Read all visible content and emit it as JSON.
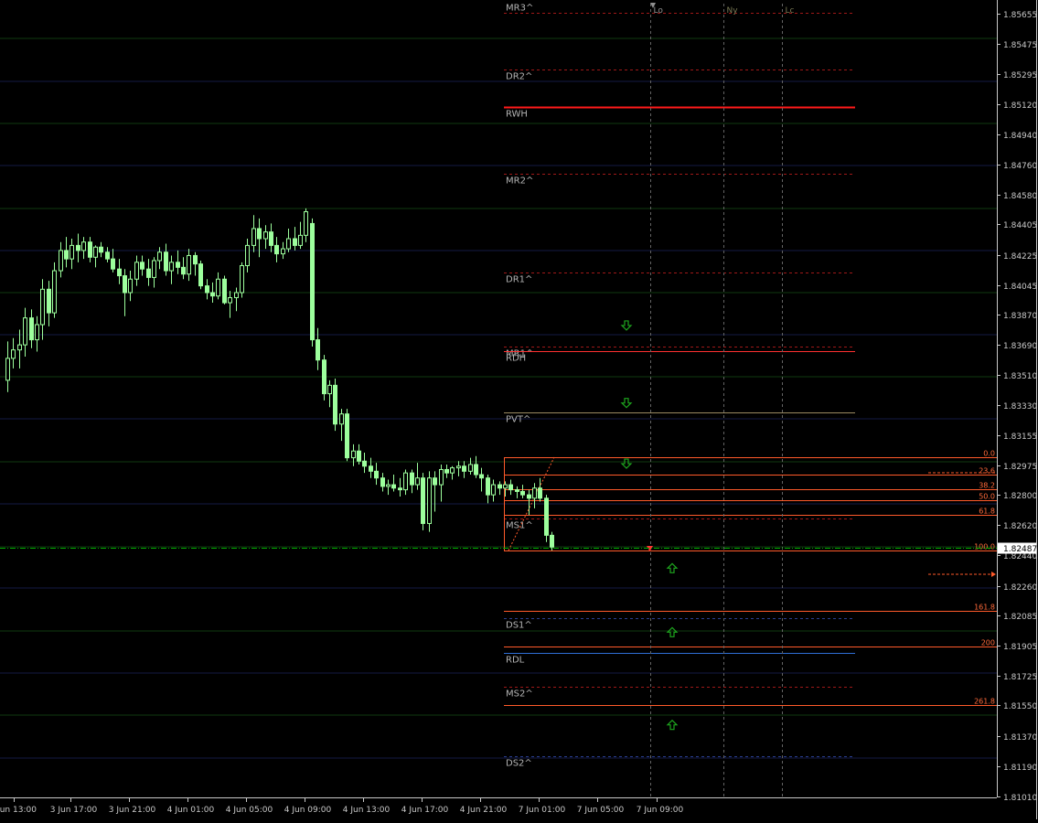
{
  "colors": {
    "background": "#000000",
    "axis": "#c8c8c8",
    "text": "#c8c8c8",
    "grid_green": "#0f3a0f",
    "grid_blue": "#141a44",
    "candle": "#9dff9d",
    "pivot_label": "#b4b4b4",
    "pivot_line_red": "#a01818",
    "pivot_line_blue": "#2a3f90",
    "rwh": "#ff1a1a",
    "rdh": "#ff3030",
    "rdl": "#2f6fd6",
    "pvt": "#9a8a60",
    "fib": "#ff5a2a",
    "fib_text": "#ff6a3a",
    "session_line": "#646464",
    "session_text_lo": "#909090",
    "session_text": "#7a7a55",
    "arrow": "#1ea51e",
    "current_line": "#00aa00",
    "price_box_bg": "#ffffff",
    "price_box_text": "#000000"
  },
  "chart_data": {
    "type": "candlestick",
    "title": "",
    "xlabel": "",
    "ylabel": "",
    "ylim": [
      1.81005,
      1.8575
    ],
    "y_ticks": [
      "1.85655",
      "1.85475",
      "1.85295",
      "1.85120",
      "1.84940",
      "1.84760",
      "1.84580",
      "1.84405",
      "1.84225",
      "1.84045",
      "1.83870",
      "1.83690",
      "1.83510",
      "1.83330",
      "1.83155",
      "1.82975",
      "1.82800",
      "1.82620",
      "1.82440",
      "1.82260",
      "1.82085",
      "1.81905",
      "1.81725",
      "1.81550",
      "1.81370",
      "1.81190",
      "1.81010"
    ],
    "x_ticks": [
      "Jun 13:00",
      "3 Jun 17:00",
      "3 Jun 21:00",
      "4 Jun 01:00",
      "4 Jun 05:00",
      "4 Jun 09:00",
      "4 Jun 13:00",
      "4 Jun 17:00",
      "4 Jun 21:00",
      "7 Jun 01:00",
      "7 Jun 05:00",
      "7 Jun 09:00"
    ],
    "current_price": "1.82487",
    "candles": [
      {
        "o": 1.8348,
        "h": 1.8371,
        "l": 1.8341,
        "c": 1.8361
      },
      {
        "o": 1.8361,
        "h": 1.8373,
        "l": 1.8355,
        "c": 1.8366
      },
      {
        "o": 1.8366,
        "h": 1.8378,
        "l": 1.8355,
        "c": 1.8369
      },
      {
        "o": 1.8369,
        "h": 1.8391,
        "l": 1.8362,
        "c": 1.8385
      },
      {
        "o": 1.8385,
        "h": 1.839,
        "l": 1.8367,
        "c": 1.8372
      },
      {
        "o": 1.8372,
        "h": 1.8386,
        "l": 1.8365,
        "c": 1.8381
      },
      {
        "o": 1.8381,
        "h": 1.8408,
        "l": 1.8372,
        "c": 1.8402
      },
      {
        "o": 1.8402,
        "h": 1.8407,
        "l": 1.838,
        "c": 1.8388
      },
      {
        "o": 1.8388,
        "h": 1.8418,
        "l": 1.8385,
        "c": 1.8413
      },
      {
        "o": 1.8413,
        "h": 1.843,
        "l": 1.8409,
        "c": 1.8425
      },
      {
        "o": 1.8425,
        "h": 1.8433,
        "l": 1.8415,
        "c": 1.842
      },
      {
        "o": 1.842,
        "h": 1.8432,
        "l": 1.8414,
        "c": 1.8428
      },
      {
        "o": 1.8428,
        "h": 1.8435,
        "l": 1.8418,
        "c": 1.8425
      },
      {
        "o": 1.8425,
        "h": 1.8433,
        "l": 1.842,
        "c": 1.843
      },
      {
        "o": 1.843,
        "h": 1.8433,
        "l": 1.8418,
        "c": 1.8421
      },
      {
        "o": 1.8421,
        "h": 1.8428,
        "l": 1.8415,
        "c": 1.8427
      },
      {
        "o": 1.8427,
        "h": 1.843,
        "l": 1.8421,
        "c": 1.8424
      },
      {
        "o": 1.8424,
        "h": 1.8427,
        "l": 1.8418,
        "c": 1.842
      },
      {
        "o": 1.842,
        "h": 1.8426,
        "l": 1.8412,
        "c": 1.8414
      },
      {
        "o": 1.8414,
        "h": 1.842,
        "l": 1.8405,
        "c": 1.841
      },
      {
        "o": 1.841,
        "h": 1.8414,
        "l": 1.8386,
        "c": 1.84
      },
      {
        "o": 1.84,
        "h": 1.8413,
        "l": 1.8395,
        "c": 1.8408
      },
      {
        "o": 1.8408,
        "h": 1.8422,
        "l": 1.8404,
        "c": 1.8418
      },
      {
        "o": 1.8418,
        "h": 1.8422,
        "l": 1.841,
        "c": 1.8414
      },
      {
        "o": 1.8414,
        "h": 1.842,
        "l": 1.8404,
        "c": 1.8409
      },
      {
        "o": 1.8409,
        "h": 1.8421,
        "l": 1.8403,
        "c": 1.8419
      },
      {
        "o": 1.8419,
        "h": 1.8427,
        "l": 1.8414,
        "c": 1.8424
      },
      {
        "o": 1.8424,
        "h": 1.8429,
        "l": 1.841,
        "c": 1.8413
      },
      {
        "o": 1.8413,
        "h": 1.8422,
        "l": 1.8405,
        "c": 1.8418
      },
      {
        "o": 1.8418,
        "h": 1.8425,
        "l": 1.8411,
        "c": 1.8415
      },
      {
        "o": 1.8415,
        "h": 1.8421,
        "l": 1.8408,
        "c": 1.8411
      },
      {
        "o": 1.8411,
        "h": 1.8426,
        "l": 1.8407,
        "c": 1.8422
      },
      {
        "o": 1.8422,
        "h": 1.8424,
        "l": 1.841,
        "c": 1.8417
      },
      {
        "o": 1.8417,
        "h": 1.8419,
        "l": 1.8402,
        "c": 1.8404
      },
      {
        "o": 1.8404,
        "h": 1.8408,
        "l": 1.8396,
        "c": 1.84
      },
      {
        "o": 1.84,
        "h": 1.8406,
        "l": 1.8394,
        "c": 1.8398
      },
      {
        "o": 1.8398,
        "h": 1.8412,
        "l": 1.8396,
        "c": 1.8408
      },
      {
        "o": 1.8408,
        "h": 1.841,
        "l": 1.8393,
        "c": 1.8394
      },
      {
        "o": 1.8394,
        "h": 1.8401,
        "l": 1.8385,
        "c": 1.8397
      },
      {
        "o": 1.8397,
        "h": 1.8403,
        "l": 1.8389,
        "c": 1.84
      },
      {
        "o": 1.84,
        "h": 1.8418,
        "l": 1.8397,
        "c": 1.8416
      },
      {
        "o": 1.8416,
        "h": 1.8432,
        "l": 1.8412,
        "c": 1.8428
      },
      {
        "o": 1.8428,
        "h": 1.8446,
        "l": 1.8424,
        "c": 1.8438
      },
      {
        "o": 1.8438,
        "h": 1.8444,
        "l": 1.8421,
        "c": 1.8432
      },
      {
        "o": 1.8432,
        "h": 1.844,
        "l": 1.8426,
        "c": 1.8436
      },
      {
        "o": 1.8436,
        "h": 1.8441,
        "l": 1.8424,
        "c": 1.8428
      },
      {
        "o": 1.8428,
        "h": 1.8433,
        "l": 1.8418,
        "c": 1.8423
      },
      {
        "o": 1.8423,
        "h": 1.843,
        "l": 1.842,
        "c": 1.8426
      },
      {
        "o": 1.8426,
        "h": 1.8438,
        "l": 1.8424,
        "c": 1.8432
      },
      {
        "o": 1.8432,
        "h": 1.8439,
        "l": 1.8425,
        "c": 1.8428
      },
      {
        "o": 1.8428,
        "h": 1.8442,
        "l": 1.8426,
        "c": 1.8434
      },
      {
        "o": 1.8434,
        "h": 1.845,
        "l": 1.843,
        "c": 1.8448
      },
      {
        "o": 1.8441,
        "h": 1.8444,
        "l": 1.8368,
        "c": 1.8372
      },
      {
        "o": 1.8372,
        "h": 1.8379,
        "l": 1.8354,
        "c": 1.836
      },
      {
        "o": 1.836,
        "h": 1.8363,
        "l": 1.8336,
        "c": 1.834
      },
      {
        "o": 1.834,
        "h": 1.8348,
        "l": 1.8332,
        "c": 1.8345
      },
      {
        "o": 1.8345,
        "h": 1.8349,
        "l": 1.8318,
        "c": 1.8322
      },
      {
        "o": 1.8322,
        "h": 1.8331,
        "l": 1.8312,
        "c": 1.8328
      },
      {
        "o": 1.8328,
        "h": 1.8331,
        "l": 1.83,
        "c": 1.8302
      },
      {
        "o": 1.8302,
        "h": 1.831,
        "l": 1.8297,
        "c": 1.8306
      },
      {
        "o": 1.8306,
        "h": 1.831,
        "l": 1.8298,
        "c": 1.83
      },
      {
        "o": 1.83,
        "h": 1.8305,
        "l": 1.8293,
        "c": 1.8297
      },
      {
        "o": 1.8297,
        "h": 1.8302,
        "l": 1.829,
        "c": 1.8294
      },
      {
        "o": 1.8294,
        "h": 1.8299,
        "l": 1.8286,
        "c": 1.829
      },
      {
        "o": 1.829,
        "h": 1.8293,
        "l": 1.8282,
        "c": 1.8285
      },
      {
        "o": 1.8285,
        "h": 1.8289,
        "l": 1.828,
        "c": 1.8286
      },
      {
        "o": 1.8286,
        "h": 1.8292,
        "l": 1.8282,
        "c": 1.8284
      },
      {
        "o": 1.8284,
        "h": 1.829,
        "l": 1.8279,
        "c": 1.8283
      },
      {
        "o": 1.8283,
        "h": 1.8295,
        "l": 1.828,
        "c": 1.8293
      },
      {
        "o": 1.8293,
        "h": 1.8295,
        "l": 1.8281,
        "c": 1.8286
      },
      {
        "o": 1.8286,
        "h": 1.8299,
        "l": 1.8283,
        "c": 1.829
      },
      {
        "o": 1.829,
        "h": 1.8293,
        "l": 1.8259,
        "c": 1.8263
      },
      {
        "o": 1.8263,
        "h": 1.8294,
        "l": 1.8258,
        "c": 1.829
      },
      {
        "o": 1.829,
        "h": 1.8294,
        "l": 1.827,
        "c": 1.8286
      },
      {
        "o": 1.8286,
        "h": 1.8298,
        "l": 1.8276,
        "c": 1.8295
      },
      {
        "o": 1.8295,
        "h": 1.8298,
        "l": 1.829,
        "c": 1.8293
      },
      {
        "o": 1.8293,
        "h": 1.8297,
        "l": 1.8289,
        "c": 1.8296
      },
      {
        "o": 1.8296,
        "h": 1.83,
        "l": 1.8291,
        "c": 1.8297
      },
      {
        "o": 1.8297,
        "h": 1.83,
        "l": 1.829,
        "c": 1.8294
      },
      {
        "o": 1.8294,
        "h": 1.8302,
        "l": 1.8292,
        "c": 1.8298
      },
      {
        "o": 1.8298,
        "h": 1.8303,
        "l": 1.829,
        "c": 1.8292
      },
      {
        "o": 1.8292,
        "h": 1.8296,
        "l": 1.8282,
        "c": 1.829
      },
      {
        "o": 1.829,
        "h": 1.8292,
        "l": 1.8275,
        "c": 1.828
      },
      {
        "o": 1.828,
        "h": 1.8289,
        "l": 1.8276,
        "c": 1.8286
      },
      {
        "o": 1.8286,
        "h": 1.8288,
        "l": 1.828,
        "c": 1.8284
      },
      {
        "o": 1.8284,
        "h": 1.8288,
        "l": 1.8279,
        "c": 1.8286
      },
      {
        "o": 1.8286,
        "h": 1.8289,
        "l": 1.828,
        "c": 1.8283
      },
      {
        "o": 1.8283,
        "h": 1.8285,
        "l": 1.8278,
        "c": 1.8282
      },
      {
        "o": 1.8282,
        "h": 1.8286,
        "l": 1.8278,
        "c": 1.828
      },
      {
        "o": 1.828,
        "h": 1.8283,
        "l": 1.8268,
        "c": 1.8278
      },
      {
        "o": 1.8278,
        "h": 1.8287,
        "l": 1.8272,
        "c": 1.8284
      },
      {
        "o": 1.8284,
        "h": 1.829,
        "l": 1.8276,
        "c": 1.8278
      },
      {
        "o": 1.8278,
        "h": 1.828,
        "l": 1.8252,
        "c": 1.8256
      },
      {
        "o": 1.8256,
        "h": 1.8258,
        "l": 1.8247,
        "c": 1.8249
      }
    ],
    "levels": [
      {
        "label": "MR3^",
        "price": 1.85662,
        "style": "dash",
        "color_key": "pivot_line_red",
        "label_pos": "above"
      },
      {
        "label": "DR2^",
        "price": 1.85325,
        "style": "dash",
        "color_key": "pivot_line_red",
        "label_pos": "below"
      },
      {
        "label": "RWH",
        "price": 1.851,
        "style": "solid",
        "color_key": "rwh",
        "label_pos": "below"
      },
      {
        "label": "MR2^",
        "price": 1.84705,
        "style": "dash",
        "color_key": "pivot_line_red",
        "label_pos": "below"
      },
      {
        "label": "DR1^",
        "price": 1.8412,
        "style": "dash",
        "color_key": "pivot_line_red",
        "label_pos": "below"
      },
      {
        "label": "MR1^",
        "price": 1.8368,
        "style": "dash",
        "color_key": "pivot_line_red",
        "label_pos": "below"
      },
      {
        "label": "RDH",
        "price": 1.83655,
        "style": "solid",
        "color_key": "rdh",
        "label_pos": "below"
      },
      {
        "label": "PVT^",
        "price": 1.8329,
        "style": "solid",
        "color_key": "pvt",
        "label_pos": "below"
      },
      {
        "label": "MS1^",
        "price": 1.8266,
        "style": "dash",
        "color_key": "pivot_line_red",
        "label_pos": "below"
      },
      {
        "label": "DS1^",
        "price": 1.8207,
        "style": "dash",
        "color_key": "pivot_line_blue",
        "label_pos": "below"
      },
      {
        "label": "RDL",
        "price": 1.8186,
        "style": "solid",
        "color_key": "rdl",
        "label_pos": "below"
      },
      {
        "label": "MS2^",
        "price": 1.8166,
        "style": "dash",
        "color_key": "pivot_line_red",
        "label_pos": "below"
      },
      {
        "label": "DS2^",
        "price": 1.8125,
        "style": "dash",
        "color_key": "pivot_line_blue",
        "label_pos": "below"
      }
    ],
    "fibonacci": [
      {
        "label": "0.0",
        "price": 1.83025
      },
      {
        "label": "23.6",
        "price": 1.82918
      },
      {
        "label": "38.2",
        "price": 1.82832
      },
      {
        "label": "50.0",
        "price": 1.82768
      },
      {
        "label": "61.8",
        "price": 1.8268
      },
      {
        "label": "100.0",
        "price": 1.82467
      },
      {
        "label": "161.8",
        "price": 1.8211
      },
      {
        "label": "200",
        "price": 1.81898
      },
      {
        "label": "261.8",
        "price": 1.81552
      }
    ],
    "sessions": [
      "Lo",
      "Ny",
      "Lc"
    ],
    "signals": [
      {
        "dir": "down",
        "price": 1.83805
      },
      {
        "dir": "down",
        "price": 1.83345
      },
      {
        "dir": "down",
        "price": 1.82985
      },
      {
        "dir": "up",
        "price": 1.82365
      },
      {
        "dir": "up",
        "price": 1.81985
      },
      {
        "dir": "up",
        "price": 1.81435
      }
    ]
  }
}
